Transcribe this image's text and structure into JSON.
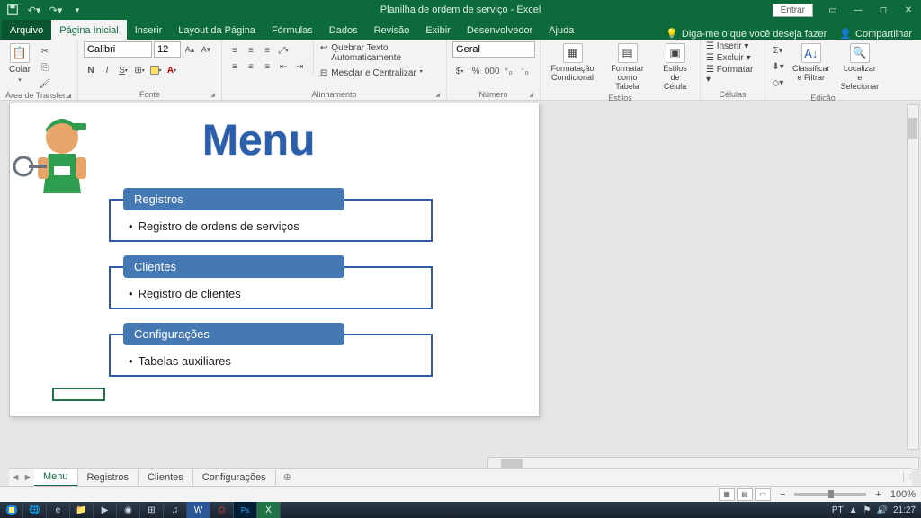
{
  "titlebar": {
    "title": "Planilha de ordem de serviço - Excel",
    "signin": "Entrar"
  },
  "tabs": {
    "file": "Arquivo",
    "home": "Página Inicial",
    "insert": "Inserir",
    "layout": "Layout da Página",
    "formulas": "Fórmulas",
    "data": "Dados",
    "review": "Revisão",
    "view": "Exibir",
    "developer": "Desenvolvedor",
    "help": "Ajuda",
    "tellme": "Diga-me o que você deseja fazer",
    "share": "Compartilhar"
  },
  "ribbon": {
    "clipboard": {
      "paste": "Colar",
      "label": "Área de Transfer..."
    },
    "font": {
      "name": "Calibri",
      "size": "12",
      "label": "Fonte"
    },
    "align": {
      "wrap": "Quebrar Texto Automaticamente",
      "merge": "Mesclar e Centralizar",
      "label": "Alinhamento"
    },
    "number": {
      "format": "Geral",
      "label": "Número"
    },
    "styles": {
      "cond": "Formatação Condicional",
      "table": "Formatar como Tabela",
      "cell": "Estilos de Célula",
      "label": "Estilos"
    },
    "cells": {
      "insert": "Inserir",
      "delete": "Excluir",
      "format": "Formatar",
      "label": "Células"
    },
    "editing": {
      "sort": "Classificar e Filtrar",
      "find": "Localizar e Selecionar",
      "label": "Edição"
    }
  },
  "menu": {
    "title": "Menu",
    "sections": [
      {
        "header": "Registros",
        "item": "Registro de ordens de serviços"
      },
      {
        "header": "Clientes",
        "item": "Registro de clientes"
      },
      {
        "header": "Configurações",
        "item": "Tabelas auxiliares"
      }
    ]
  },
  "sheets": {
    "tabs": [
      "Menu",
      "Registros",
      "Clientes",
      "Configurações"
    ],
    "active": 0
  },
  "status": {
    "lang": "PT",
    "zoom": "100%",
    "clock": "21:27"
  }
}
